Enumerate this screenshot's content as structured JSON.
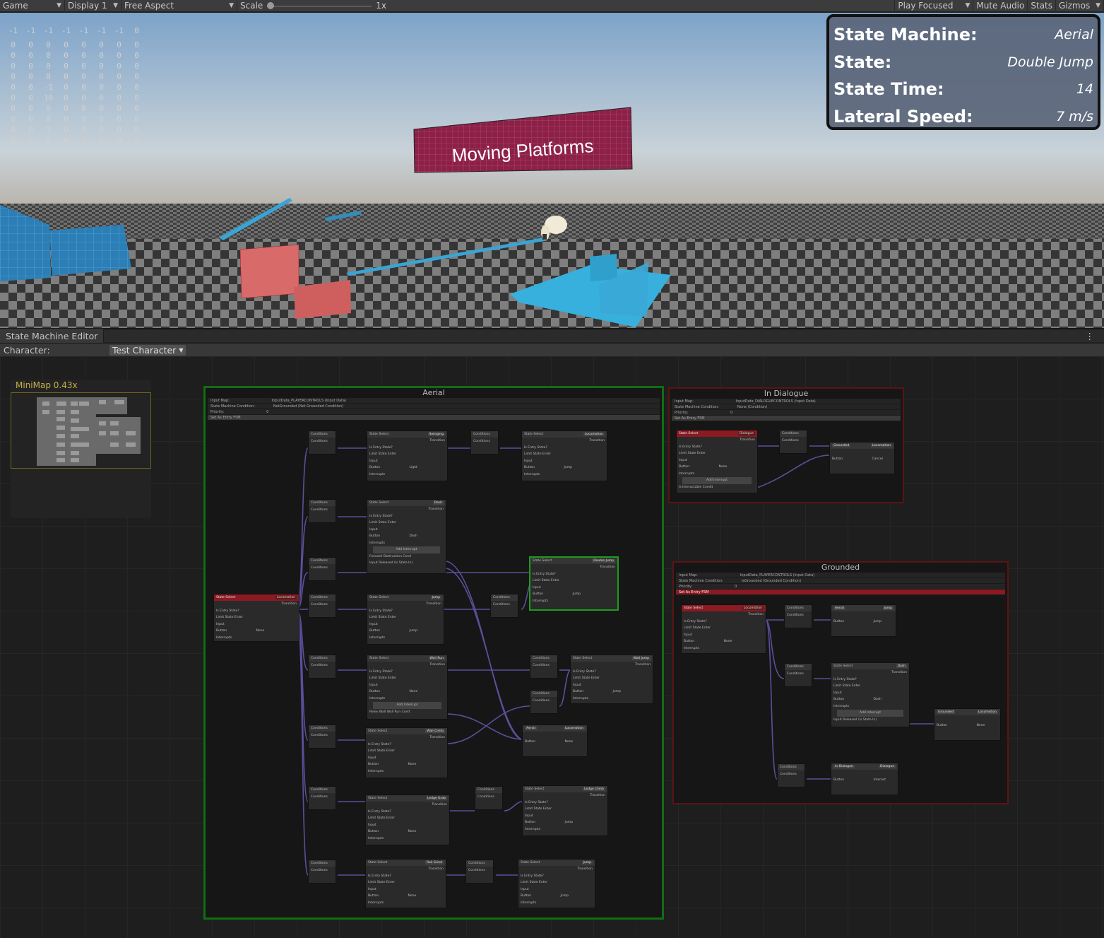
{
  "toolbar": {
    "game_tab": "Game",
    "display": "Display 1",
    "aspect": "Free Aspect",
    "scale_label": "Scale",
    "scale_value": "1x",
    "play_focused": "Play Focused",
    "mute_audio": "Mute Audio",
    "stats": "Stats",
    "gizmos": "Gizmos"
  },
  "debug_grid": [
    [
      "-1",
      "-1",
      "-1",
      "-1",
      "-1",
      "-1",
      "-1",
      "0"
    ],
    [
      "0",
      "0",
      "0",
      "0",
      "0",
      "0",
      "0",
      "0"
    ],
    [
      "0",
      "0",
      "0",
      "0",
      "0",
      "0",
      "0",
      "0"
    ],
    [
      "0",
      "0",
      "0",
      "0",
      "0",
      "0",
      "0",
      "0"
    ],
    [
      "0",
      "0",
      "0",
      "0",
      "0",
      "0",
      "0",
      "0"
    ],
    [
      "0",
      "0",
      "-1",
      "0",
      "0",
      "0",
      "0",
      "0"
    ],
    [
      "0",
      "0",
      "10",
      "0",
      "0",
      "0",
      "0",
      "0"
    ],
    [
      "0",
      "0",
      "9",
      "0",
      "0",
      "0",
      "0",
      "0"
    ],
    [
      "0",
      "0",
      "8",
      "0",
      "0",
      "0",
      "0",
      "0"
    ],
    [
      "0",
      "0",
      "7",
      "0",
      "0",
      "0",
      "0",
      "0"
    ],
    [
      "0",
      "0",
      "6",
      "0",
      "0",
      "0",
      "0",
      "0"
    ]
  ],
  "hud": {
    "state_machine_label": "State Machine:",
    "state_machine_value": "Aerial",
    "state_label": "State:",
    "state_value": "Double Jump",
    "state_time_label": "State Time:",
    "state_time_value": "14",
    "lateral_speed_label": "Lateral Speed:",
    "lateral_speed_value": "7 m/s"
  },
  "scene": {
    "banner_text": "Moving Platforms"
  },
  "editor": {
    "tab_title": "State Machine Editor",
    "character_label": "Character:",
    "character_value": "Test Character",
    "minimap_title": "MiniMap  0.43x"
  },
  "machines": {
    "aerial": {
      "title": "Aerial",
      "input_map_label": "Input Map:",
      "input_map_value": "InputData_PLAYERCONTROLS (Input Data)",
      "condition_label": "State Machine Condition:",
      "condition_value": "NotGrounded (Not Grounded Condition)",
      "priority_label": "Priority:",
      "priority_value": "0",
      "entry_button": "Set As Entry FSM"
    },
    "dialogue": {
      "title": "In Dialogue",
      "input_map_label": "Input Map:",
      "input_map_value": "InputData_DIALOGUECONTROLS (Input Data)",
      "condition_label": "State Machine Condition:",
      "condition_value": "None (Condition)",
      "priority_label": "Priority:",
      "priority_value": "0",
      "entry_button": "Set As Entry FSM"
    },
    "grounded": {
      "title": "Grounded",
      "input_map_label": "Input Map:",
      "input_map_value": "InputData_PLAYERCONTROLS (Input Data)",
      "condition_label": "State Machine Condition:",
      "condition_value": "IsGrounded (Grounded Condition)",
      "priority_label": "Priority:",
      "priority_value": "0",
      "entry_button": "Set As Entry FSM"
    }
  },
  "labels": {
    "state_select": "State Select",
    "conditions": "Conditions",
    "transition": "Transition",
    "is_entry": "Is Entry State?",
    "limit_enter": "Limit State Enter",
    "input": "Input",
    "button": "Button",
    "interrupts": "Interrupts",
    "add_interrupt": "Add Interrupt"
  },
  "nodes": {
    "aerial_entry": {
      "state": "Locomotion",
      "button": "None"
    },
    "aerial_swinging": {
      "state": "Swinging",
      "button": "Light"
    },
    "aerial_locomotion_top": {
      "state": "Locomotion",
      "button": "Jump"
    },
    "aerial_dash": {
      "state": "Dash",
      "button": "Dash",
      "interrupt1": "Forward Obstruction Cond",
      "interrupt2": "Input Released (Is State In)"
    },
    "aerial_double_jump": {
      "state": "Double Jump",
      "button": "Jump"
    },
    "aerial_jump": {
      "state": "Jump",
      "button": "Jump"
    },
    "aerial_wall_run": {
      "state": "Wall Run",
      "button": "None",
      "interrupt1": "Relev Wall Wall Run Cond"
    },
    "aerial_wall_jump": {
      "state": "Wall Jump",
      "button": "Jump"
    },
    "aerial_wall_climb": {
      "state": "Wall Climb",
      "button": "None"
    },
    "aerial_exit": {
      "state": "Aerial",
      "target": "Locomotion",
      "button": "None"
    },
    "aerial_ledge_grab": {
      "state": "Ledge Grab",
      "button": "None"
    },
    "aerial_ledge_climb": {
      "state": "Ledge Climb",
      "button": "Jump"
    },
    "aerial_ball_grind": {
      "state": "Rail Grind",
      "button": "None"
    },
    "aerial_jump2": {
      "state": "Jump",
      "button": "Jump"
    },
    "dlg_state": {
      "state": "Dialogue",
      "button": "None",
      "interrupt1": "Is Interactable Condit"
    },
    "dlg_exit": {
      "state": "Grounded",
      "target": "Locomotion",
      "button": "Cancel"
    },
    "gr_entry": {
      "state": "Locomotion",
      "button": "None"
    },
    "gr_jump": {
      "state": "Aerial",
      "target": "Jump",
      "button": "Jump"
    },
    "gr_dash": {
      "state": "Dash",
      "button": "Dash",
      "interrupt1": "Input Released (Is State In)"
    },
    "gr_dash_exit": {
      "state": "Grounded",
      "target": "Locomotion",
      "button": "None"
    },
    "gr_dialogue": {
      "state": "In Dialogue",
      "target": "Dialogue",
      "button": "Interact"
    }
  }
}
